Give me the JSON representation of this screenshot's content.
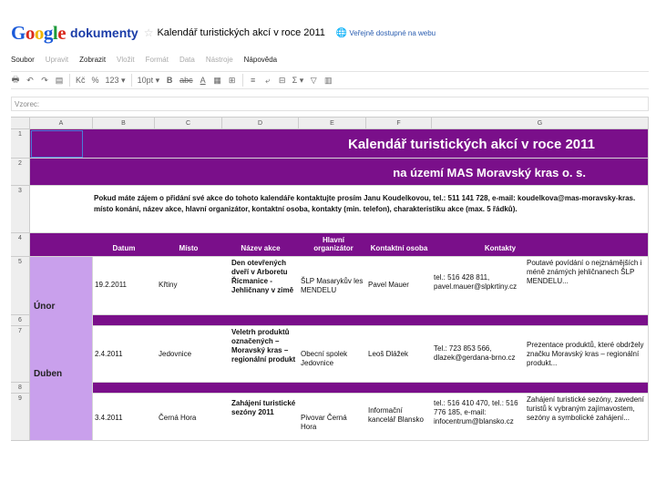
{
  "app": {
    "logo": [
      "G",
      "o",
      "o",
      "g",
      "l",
      "e"
    ],
    "logo_sub": "dokumenty",
    "doc_title": "Kalendář turistických akcí v roce 2011",
    "share_status": "Veřejně dostupné na webu"
  },
  "menu": [
    {
      "label": "Soubor",
      "dim": false
    },
    {
      "label": "Upravit",
      "dim": true
    },
    {
      "label": "Zobrazit",
      "dim": false
    },
    {
      "label": "Vložit",
      "dim": true
    },
    {
      "label": "Formát",
      "dim": true
    },
    {
      "label": "Data",
      "dim": true
    },
    {
      "label": "Nástroje",
      "dim": true
    },
    {
      "label": "Nápověda",
      "dim": false
    }
  ],
  "toolbar": {
    "print": "🖶",
    "undo": "↶",
    "redo": "↷",
    "paint": "▤",
    "currency": "Kč",
    "percent": "%",
    "number_format": "123 ▾",
    "font_size": "10pt ▾",
    "bold": "B",
    "strike": "abc",
    "text_color": "A",
    "fill": "▦",
    "borders": "⊞",
    "align": "≡",
    "wrap": "⤶",
    "merge": "⊟",
    "sum": "Σ ▾",
    "filter": "▽",
    "chart": "▥"
  },
  "formula_bar": {
    "label": "Vzorec:"
  },
  "columns": [
    "A",
    "B",
    "C",
    "D",
    "E",
    "F",
    "G"
  ],
  "row_numbers": [
    "1",
    "2",
    "3",
    "4",
    "5",
    "6",
    "7",
    "8",
    "9"
  ],
  "sheet": {
    "title": "Kalendář turistických akcí v roce 2011",
    "subtitle": "na území MAS Moravský kras o. s.",
    "info_line1": "Pokud máte zájem o přidání své akce do tohoto kalendáře kontaktujte prosím Janu Koudelkovou, tel.: 511 141 728, e-mail: koudelkova@mas-moravsky-kras.",
    "info_line2": "místo konání, název akce, hlavní organizátor, kontaktní osoba, kontakty (min. telefon), charakteristiku akce (max. 5 řádků).",
    "headers": {
      "datum": "Datum",
      "misto": "Místo",
      "nazev": "Název akce",
      "organizator": "Hlavní organizátor",
      "osoba": "Kontaktní osoba",
      "kontakty": "Kontakty"
    },
    "months": [
      "Únor",
      "Duben"
    ],
    "rows": [
      {
        "datum": "19.2.2011",
        "misto": "Křtiny",
        "nazev": "Den otevřených dveří v Arboretu Řícmanice - Jehličnany v zimě",
        "organizator": "ŠLP Masarykův les MENDELU",
        "osoba": "Pavel Mauer",
        "kontakty": "tel.: 516 428 811, pavel.mauer@slpkrtiny.cz",
        "popis": "Poutavé povídání o nejznámějších i méně známých jehličnanech ŠLP MENDELU..."
      },
      {
        "datum": "2.4.2011",
        "misto": "Jedovnice",
        "nazev": "Veletrh produktů označených – Moravský kras – regionální produkt",
        "organizator": "Obecní spolek Jedovnice",
        "osoba": "Leoš Dlážek",
        "kontakty": "Tel.: 723 853 566, dlazek@gerdana-brno.cz",
        "popis": "Prezentace produktů, které obdržely značku Moravský kras – regionální produkt..."
      },
      {
        "datum": "3.4.2011",
        "misto": "Černá Hora",
        "nazev": "Zahájení turistické sezóny 2011",
        "organizator": "Pivovar Černá Hora",
        "osoba": "Informační kancelář Blansko",
        "kontakty": "tel.: 516 410 470, tel.: 516 776 185, e-mail: infocentrum@blansko.cz",
        "popis": "Zahájení turistické sezóny, zavedení turistů k vybraným zajímavostem, sezóny a symbolické zahájení..."
      }
    ]
  }
}
